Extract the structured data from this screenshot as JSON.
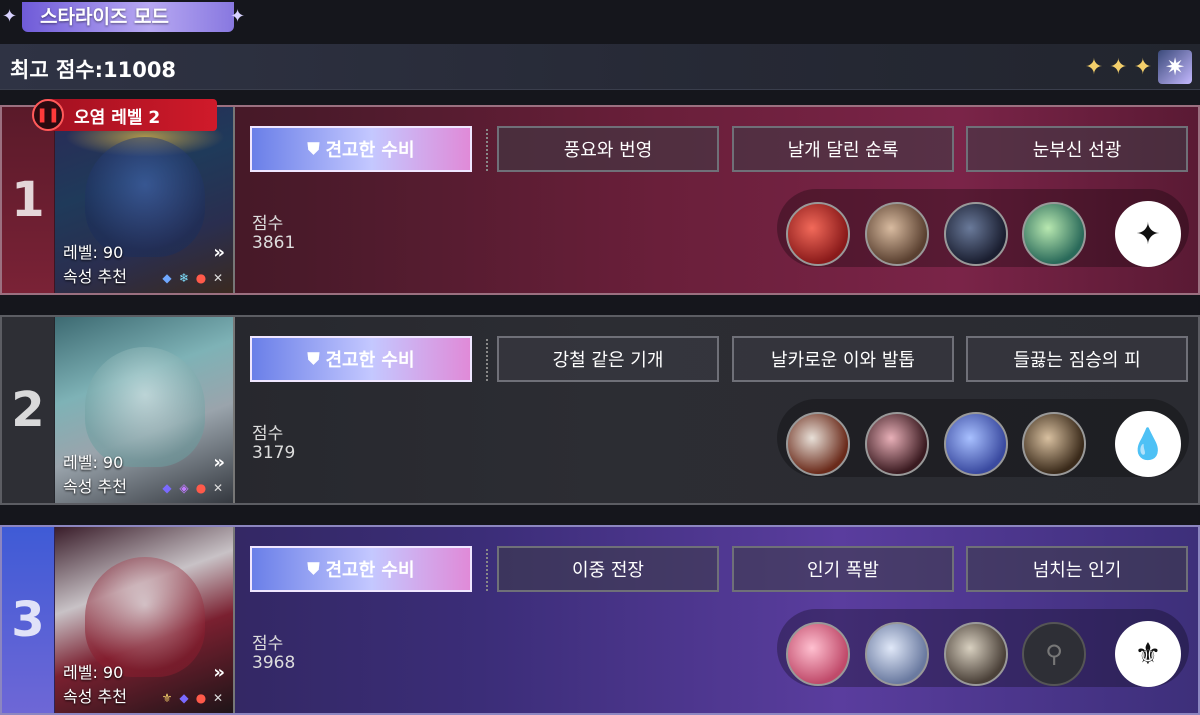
{
  "mode_title": "스타라이즈 모드",
  "best_score_text": "최고 점수:11008",
  "stars": [
    "✦",
    "✦",
    "✦"
  ],
  "badge_icon": "✷",
  "stages": [
    {
      "number": "1",
      "pollution": "오염 레벨 2",
      "level": "레벨: 90",
      "recommend": "속성 추천",
      "buffs": [
        "견고한 수비",
        "풍요와 번영",
        "날개 달린 순록",
        "눈부신 선광"
      ],
      "score_label": "점수",
      "score": "3861",
      "element_icon": "✦"
    },
    {
      "number": "2",
      "level": "레벨: 90",
      "recommend": "속성 추천",
      "buffs": [
        "견고한 수비",
        "강철 같은 기개",
        "날카로운 이와 발톱",
        "들끓는 짐승의 피"
      ],
      "score_label": "점수",
      "score": "3179",
      "element_icon": "💧"
    },
    {
      "number": "3",
      "level": "레벨: 90",
      "recommend": "속성 추천",
      "buffs": [
        "견고한 수비",
        "이중 전장",
        "인기 폭발",
        "넘치는 인기"
      ],
      "score_label": "점수",
      "score": "3968",
      "element_icon": "⚜"
    }
  ],
  "colors": {
    "accent": "#b7a8f2",
    "pollution": "#d01a2a"
  }
}
